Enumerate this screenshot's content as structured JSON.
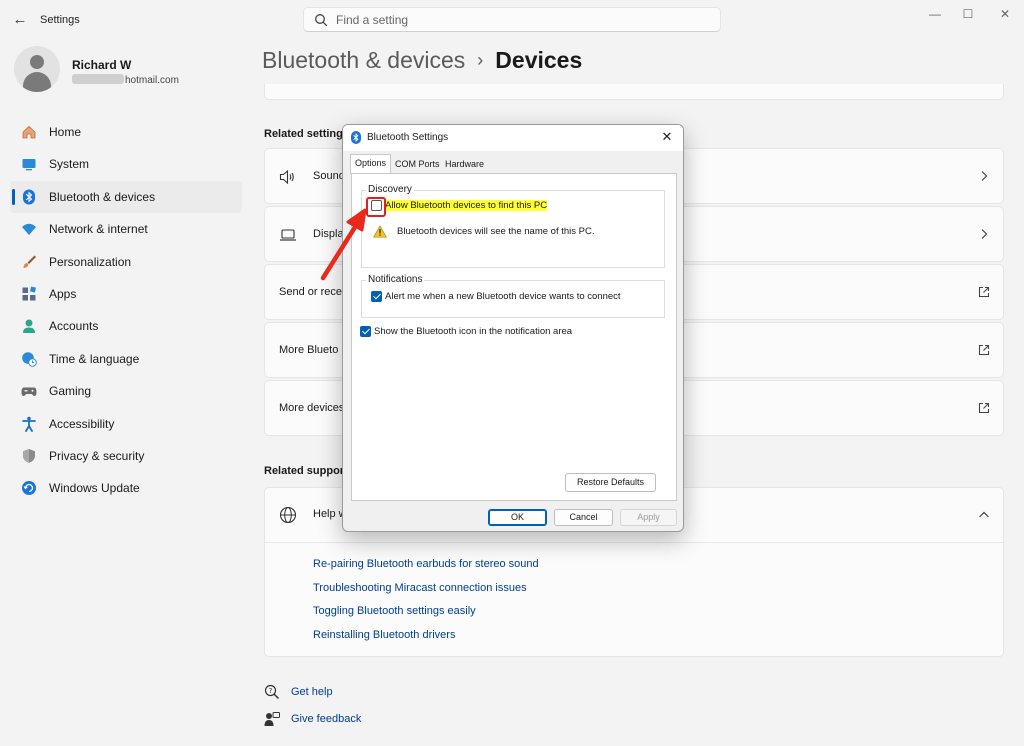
{
  "window": {
    "app_title": "Settings",
    "minimize_glyph": "—",
    "maximize_glyph": "☐",
    "close_glyph": "✕",
    "back_glyph": "←"
  },
  "search": {
    "placeholder": "Find a setting"
  },
  "profile": {
    "name": "Richard W",
    "email_visible": "hotmail.com"
  },
  "sidebar": {
    "items": [
      {
        "label": "Home",
        "icon": "home-icon"
      },
      {
        "label": "System",
        "icon": "system-icon"
      },
      {
        "label": "Bluetooth & devices",
        "icon": "bluetooth-icon",
        "active": true
      },
      {
        "label": "Network & internet",
        "icon": "wifi-icon"
      },
      {
        "label": "Personalization",
        "icon": "brush-icon"
      },
      {
        "label": "Apps",
        "icon": "apps-icon"
      },
      {
        "label": "Accounts",
        "icon": "accounts-icon"
      },
      {
        "label": "Time & language",
        "icon": "globe-clock-icon"
      },
      {
        "label": "Gaming",
        "icon": "gamepad-icon"
      },
      {
        "label": "Accessibility",
        "icon": "accessibility-icon"
      },
      {
        "label": "Privacy & security",
        "icon": "shield-icon"
      },
      {
        "label": "Windows Update",
        "icon": "update-icon"
      }
    ],
    "accent_color": "#005fb8"
  },
  "breadcrumb": {
    "parent": "Bluetooth & devices",
    "separator": "›",
    "current": "Devices"
  },
  "related_settings": {
    "title": "Related setting",
    "cards": [
      {
        "label": "Sound",
        "icon": "speaker-icon",
        "right": "chevron-right-icon"
      },
      {
        "label": "Displa",
        "icon": "laptop-icon",
        "right": "chevron-right-icon"
      },
      {
        "label": "Send or rece",
        "right": "external-link-icon"
      },
      {
        "label": "More Blueto",
        "right": "external-link-icon"
      },
      {
        "label": "More devices",
        "right": "external-link-icon"
      }
    ]
  },
  "related_support": {
    "title": "Related suppor",
    "help_label": "Help w",
    "links": [
      "Re-pairing Bluetooth earbuds for stereo sound",
      "Troubleshooting Miracast connection issues",
      "Toggling Bluetooth settings easily",
      "Reinstalling Bluetooth drivers"
    ]
  },
  "footer_links": {
    "get_help": "Get help",
    "give_feedback": "Give feedback"
  },
  "dialog": {
    "title": "Bluetooth Settings",
    "close_glyph": "✕",
    "tabs": [
      "Options",
      "COM Ports",
      "Hardware"
    ],
    "discovery": {
      "group_label": "Discovery",
      "allow_label": "Allow Bluetooth devices to find this PC",
      "allow_checked": false,
      "warning_text": "Bluetooth devices will see the name of this PC."
    },
    "notifications": {
      "group_label": "Notifications",
      "alert_label": "Alert me when a new Bluetooth device wants to connect",
      "alert_checked": true
    },
    "show_icon_label": "Show the Bluetooth icon in the notification area",
    "show_icon_checked": true,
    "restore_defaults": "Restore Defaults",
    "ok": "OK",
    "cancel": "Cancel",
    "apply": "Apply",
    "highlight_color": "#ffff33",
    "annotation_color": "#e02020"
  }
}
